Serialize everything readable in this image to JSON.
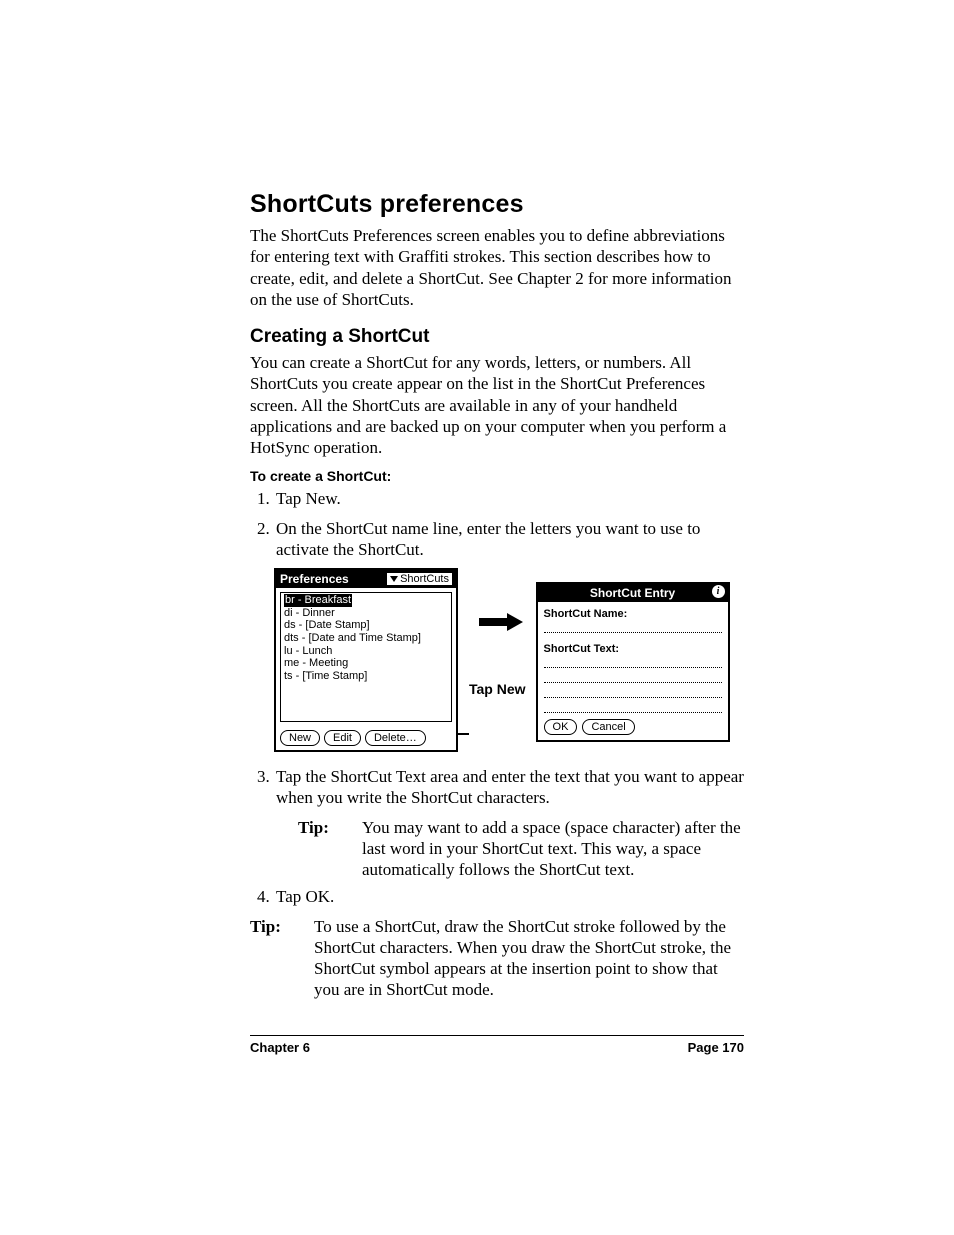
{
  "headings": {
    "h1": "ShortCuts preferences",
    "h2": "Creating a ShortCut",
    "steps": "To create a ShortCut:"
  },
  "paragraphs": {
    "intro": "The ShortCuts Preferences screen enables you to define abbreviations for entering text with Graffiti strokes. This section describes how to create, edit, and delete a ShortCut. See Chapter 2 for more information on the use of ShortCuts.",
    "create_intro": "You can create a ShortCut for any words, letters, or numbers. All ShortCuts you create appear on the list in the ShortCut Preferences screen. All the ShortCuts are available in any of your handheld applications and are backed up on your computer when you perform a HotSync operation."
  },
  "steps": {
    "s1": "Tap New.",
    "s2": "On the ShortCut name line, enter the letters you want to use to activate the ShortCut.",
    "s3": "Tap the ShortCut Text area and enter the text that you want to appear when you write the ShortCut characters.",
    "s4": "Tap OK."
  },
  "tips": {
    "label": "Tip:",
    "inner": "You may want to add a space (space character) after the last word in your ShortCut text. This way, a space automatically follows the ShortCut text.",
    "outer": "To use a ShortCut, draw the ShortCut stroke followed by the ShortCut characters. When you draw the ShortCut stroke, the ShortCut symbol appears at the insertion point to show that you are in ShortCut mode."
  },
  "callout": "Tap New",
  "prefs_screen": {
    "title": "Preferences",
    "dropdown": "ShortCuts",
    "items": [
      "br - Breakfast",
      "di - Dinner",
      "ds - [Date Stamp]",
      "dts - [Date and Time Stamp]",
      "lu - Lunch",
      "me - Meeting",
      "ts - [Time Stamp]"
    ],
    "buttons": {
      "new": "New",
      "edit": "Edit",
      "delete": "Delete…"
    }
  },
  "entry_screen": {
    "title": "ShortCut Entry",
    "name_label": "ShortCut Name:",
    "text_label": "ShortCut Text:",
    "buttons": {
      "ok": "OK",
      "cancel": "Cancel"
    }
  },
  "footer": {
    "left": "Chapter 6",
    "right": "Page 170"
  }
}
